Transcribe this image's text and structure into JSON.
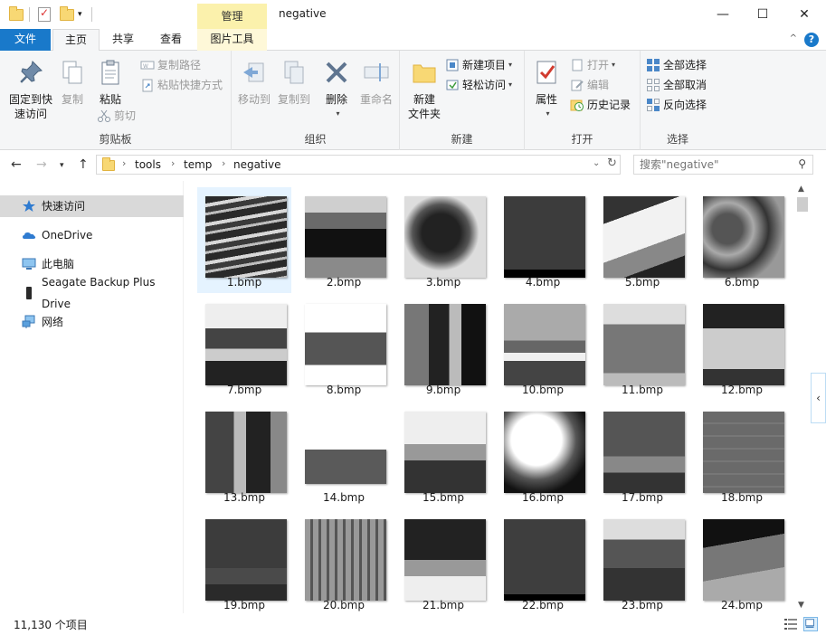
{
  "window": {
    "title": "negative",
    "context_tab": "管理",
    "minimize": "—",
    "maximize": "☐",
    "close": "✕"
  },
  "tabs": {
    "file": "文件",
    "home": "主页",
    "share": "共享",
    "view": "查看",
    "picture_tools": "图片工具"
  },
  "ribbon": {
    "clipboard": {
      "label": "剪贴板",
      "pin": "固定到快\n速访问",
      "pin_l1": "固定到快",
      "pin_l2": "速访问",
      "copy": "复制",
      "paste": "粘贴",
      "copy_path": "复制路径",
      "paste_shortcut": "粘贴快捷方式",
      "cut": "剪切"
    },
    "organize": {
      "label": "组织",
      "move_to": "移动到",
      "copy_to": "复制到",
      "delete": "删除",
      "rename": "重命名"
    },
    "new": {
      "label": "新建",
      "new_folder_l1": "新建",
      "new_folder_l2": "文件夹",
      "new_item": "新建项目",
      "easy_access": "轻松访问"
    },
    "open": {
      "label": "打开",
      "properties": "属性",
      "open": "打开",
      "edit": "编辑",
      "history": "历史记录"
    },
    "select": {
      "label": "选择",
      "select_all": "全部选择",
      "select_none": "全部取消",
      "invert": "反向选择"
    }
  },
  "address": {
    "crumbs": [
      "tools",
      "temp",
      "negative"
    ],
    "search_placeholder": "搜索\"negative\""
  },
  "nav": [
    {
      "label": "快速访问",
      "icon": "star-pin-icon",
      "selected": true
    },
    {
      "label": "OneDrive",
      "icon": "cloud-icon",
      "selected": false
    },
    {
      "label": "此电脑",
      "icon": "monitor-icon",
      "selected": false
    },
    {
      "label": "Seagate Backup Plus Drive",
      "icon": "drive-icon",
      "selected": false
    },
    {
      "label": "网络",
      "icon": "network-icon",
      "selected": false
    }
  ],
  "files": [
    {
      "name": "1.bmp"
    },
    {
      "name": "2.bmp"
    },
    {
      "name": "3.bmp"
    },
    {
      "name": "4.bmp"
    },
    {
      "name": "5.bmp"
    },
    {
      "name": "6.bmp"
    },
    {
      "name": "7.bmp"
    },
    {
      "name": "8.bmp"
    },
    {
      "name": "9.bmp"
    },
    {
      "name": "10.bmp"
    },
    {
      "name": "11.bmp"
    },
    {
      "name": "12.bmp"
    },
    {
      "name": "13.bmp"
    },
    {
      "name": "14.bmp"
    },
    {
      "name": "15.bmp"
    },
    {
      "name": "16.bmp"
    },
    {
      "name": "17.bmp"
    },
    {
      "name": "18.bmp"
    },
    {
      "name": "19.bmp"
    },
    {
      "name": "20.bmp"
    },
    {
      "name": "21.bmp"
    },
    {
      "name": "22.bmp"
    },
    {
      "name": "23.bmp"
    },
    {
      "name": "24.bmp"
    }
  ],
  "status": {
    "item_count": "11,130 个项目"
  },
  "colors": {
    "accent": "#1979ca",
    "context_tab": "#fbf1ac",
    "selected_tile": "#e5f3ff",
    "folder": "#f8d874"
  }
}
